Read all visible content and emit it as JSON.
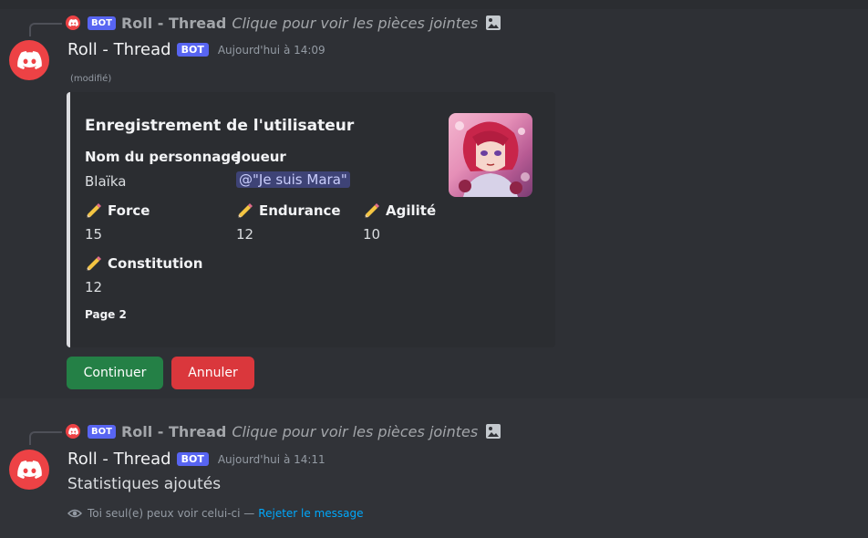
{
  "message1": {
    "reply": {
      "bot_tag": "BOT",
      "author": "Roll - Thread",
      "content": "Clique pour voir les pièces jointes",
      "attachment_icon": "image-icon"
    },
    "username": "Roll - Thread",
    "bot_tag": "BOT",
    "timestamp": "Aujourd'hui à 14:09",
    "edited": "(modifié)",
    "embed": {
      "title": "Enregistrement de l'utilisateur",
      "fields": {
        "character_name": "Nom du personnage",
        "character_value": "Blaïka",
        "player_name": "Joueur",
        "player_value": "@\"Je suis Mara\"",
        "force_name": "Force",
        "force_value": "15",
        "endurance_name": "Endurance",
        "endurance_value": "12",
        "agility_name": "Agilité",
        "agility_value": "10",
        "constitution_name": "Constitution",
        "constitution_value": "12"
      },
      "footer": "Page 2",
      "accent_color": "#dcdde1"
    },
    "buttons": {
      "continue": "Continuer",
      "cancel": "Annuler"
    }
  },
  "message2": {
    "reply": {
      "bot_tag": "BOT",
      "author": "Roll - Thread",
      "content": "Clique pour voir les pièces jointes",
      "attachment_icon": "image-icon"
    },
    "username": "Roll - Thread",
    "bot_tag": "BOT",
    "timestamp": "Aujourd'hui à 14:11",
    "content": "Statistiques ajoutés",
    "ephemeral": {
      "note": "Toi seul(e) peux voir celui-ci —",
      "dismiss": "Rejeter le message"
    }
  },
  "colors": {
    "background": "#313338",
    "blurple": "#5865f2",
    "green_button": "#248046",
    "red_button": "#da373c",
    "avatar_red": "#ed4245",
    "link": "#00a8fc"
  }
}
